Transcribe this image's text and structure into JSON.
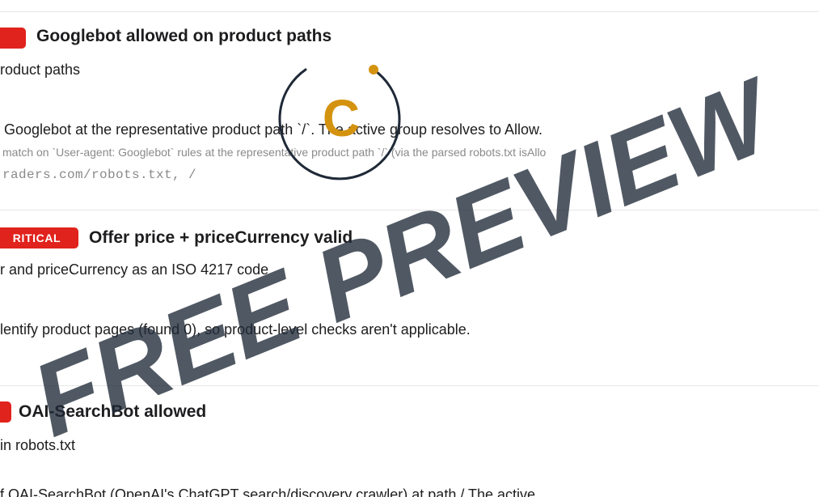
{
  "checks": [
    {
      "badge": "",
      "title": "Googlebot allowed on product paths",
      "subtitle": "roduct paths",
      "result": "Googlebot at the representative product path `/`. The active group resolves to Allow.",
      "evidence": "match on `User-agent: Googlebot` rules at the representative product path `/` (via the parsed robots.txt isAllo",
      "source": "raders.com/robots.txt, /"
    },
    {
      "badge": "RITICAL",
      "title": "Offer price + priceCurrency valid",
      "subtitle": "r and priceCurrency as an ISO 4217 code",
      "result": "lentify product pages (found 0), so product-level checks aren't applicable."
    },
    {
      "badge": "",
      "title": "OAI-SearchBot allowed",
      "subtitle": "in robots.txt",
      "result": "f    OAI-SearchBot (OpenAI's ChatGPT search/discovery crawler) at path / The active"
    }
  ],
  "watermark": {
    "text": "FREE PREVIEW",
    "logo_letter": "C",
    "text_color": "#1f2937",
    "logo_color": "#d4930f"
  }
}
